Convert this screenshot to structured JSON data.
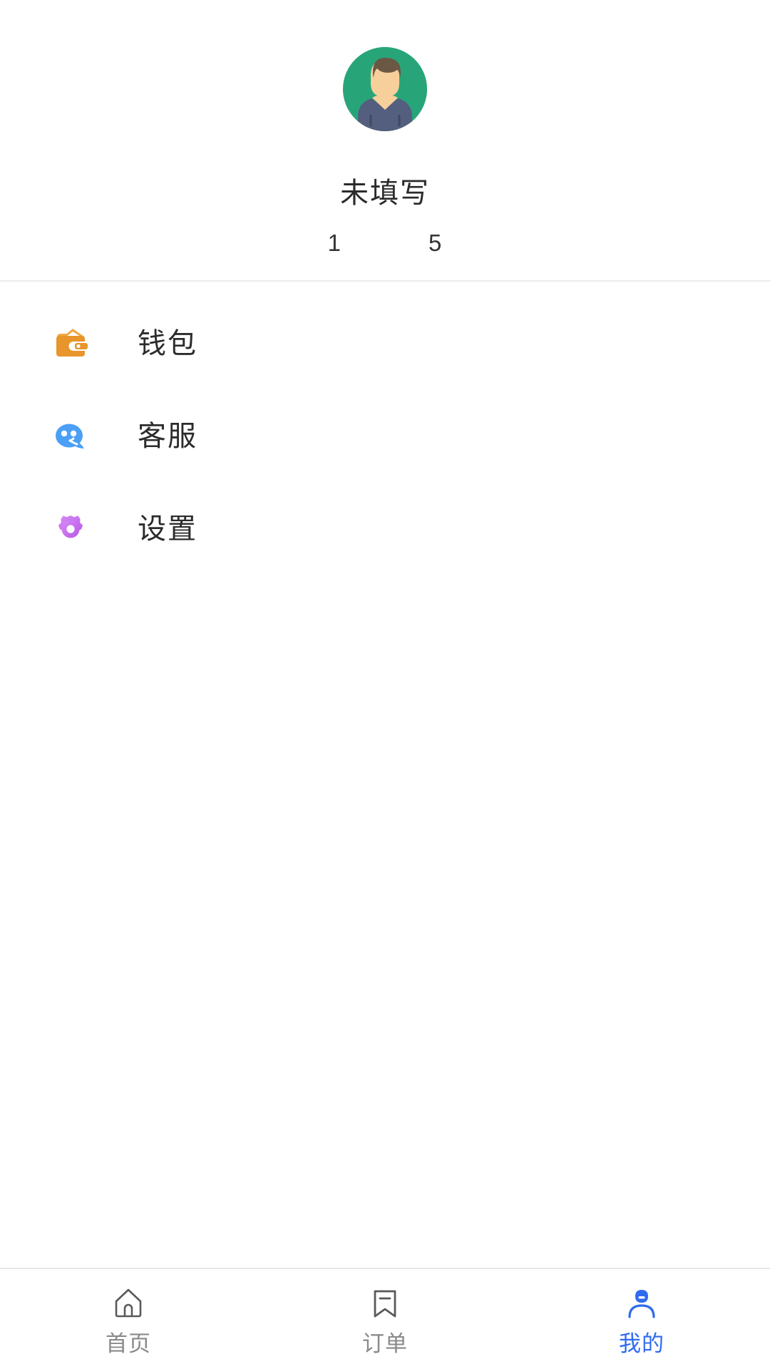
{
  "profile": {
    "avatar_icon": "user-avatar-illustration",
    "avatar_bg_color": "#27a579",
    "name": "未填写",
    "phone": "1            5"
  },
  "menu": {
    "items": [
      {
        "icon": "wallet-icon",
        "label": "钱包",
        "color": "#ef9d2e"
      },
      {
        "icon": "headset-chat-icon",
        "label": "客服",
        "color": "#4ba0f5"
      },
      {
        "icon": "gear-icon",
        "label": "设置",
        "color": "#c86bee"
      }
    ]
  },
  "tab_bar": {
    "active_color": "#2f6bf0",
    "inactive_color": "#8a8a8a",
    "items": [
      {
        "icon": "home-icon",
        "label": "首页",
        "active": false
      },
      {
        "icon": "bookmark-icon",
        "label": "订单",
        "active": false
      },
      {
        "icon": "person-icon",
        "label": "我的",
        "active": true
      }
    ]
  }
}
